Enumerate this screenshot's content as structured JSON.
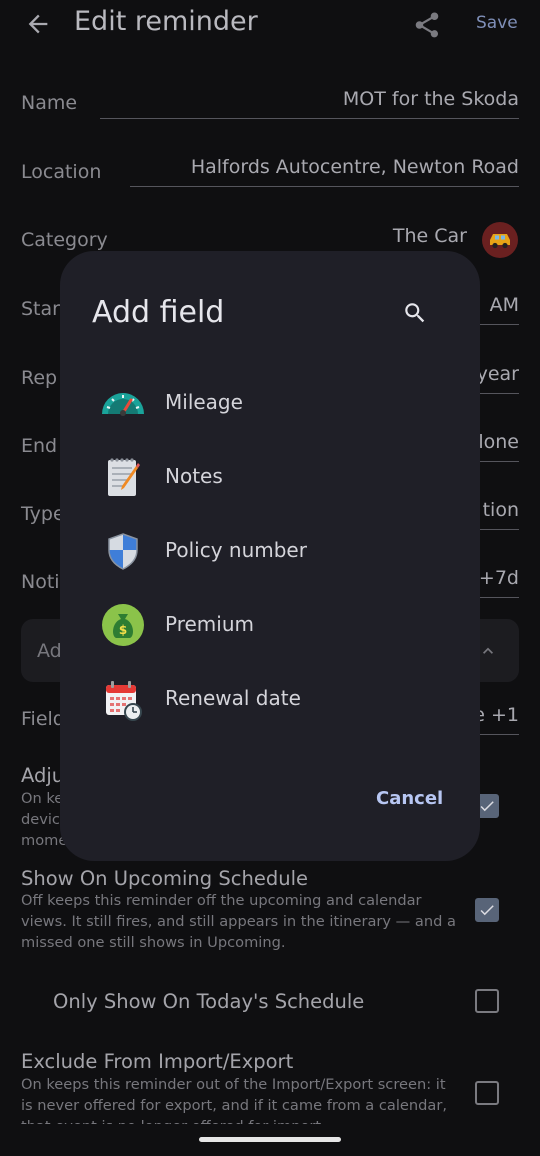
{
  "header": {
    "title": "Edit reminder",
    "save_label": "Save"
  },
  "form": {
    "name": {
      "label": "Name",
      "value": "MOT for the Skoda"
    },
    "location": {
      "label": "Location",
      "value": "Halfords Autocentre, Newton Road"
    },
    "category": {
      "label": "Category",
      "value": "The Car"
    },
    "start": {
      "label": "Star",
      "value": "AM"
    },
    "repeat": {
      "label": "Rep",
      "value": "year"
    },
    "end": {
      "label": "End",
      "value": "lone"
    },
    "type": {
      "label": "Type",
      "value": "tion"
    },
    "notify": {
      "label": "Noti",
      "value": "+7d"
    },
    "advanced": {
      "label": "Ad"
    },
    "fields": {
      "label": "Field",
      "value": "e +1"
    }
  },
  "options": {
    "adjust": {
      "title": "Adju",
      "desc_lines": [
        "On kee",
        "devic",
        "mome"
      ],
      "checked": true
    },
    "show_upcoming": {
      "title": "Show On Upcoming Schedule",
      "desc": "Off keeps this reminder off the upcoming and calendar views. It still fires, and still appears in the itinerary — and a missed one still shows in Upcoming.",
      "checked": true
    },
    "only_today": {
      "title": "Only Show On Today's Schedule",
      "checked": false
    },
    "exclude_import": {
      "title": "Exclude From Import/Export",
      "desc": "On keeps this reminder out of the Import/Export screen: it is never offered for export, and if it came from a calendar, that event is no longer offered for import.",
      "checked": false
    }
  },
  "dialog": {
    "title": "Add field",
    "items": [
      {
        "label": "Mileage",
        "icon": "speedometer-icon"
      },
      {
        "label": "Notes",
        "icon": "notepad-icon"
      },
      {
        "label": "Policy number",
        "icon": "shield-icon"
      },
      {
        "label": "Premium",
        "icon": "money-bag-icon"
      },
      {
        "label": "Renewal date",
        "icon": "calendar-clock-icon"
      }
    ],
    "cancel_label": "Cancel"
  },
  "colors": {
    "background": "#0f0f11",
    "dialog": "#1f1f27",
    "accent": "#b7c6f2"
  }
}
